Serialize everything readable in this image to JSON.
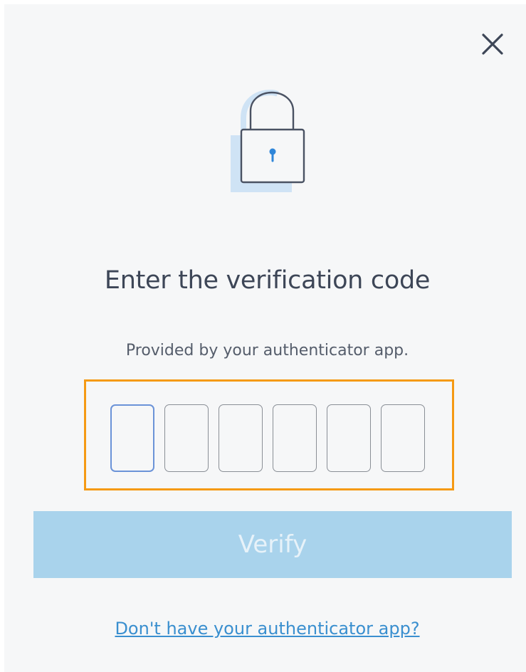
{
  "dialog": {
    "title": "Enter the verification code",
    "subtitle": "Provided by your authenticator app.",
    "code_length": 6,
    "code_digits": [
      "",
      "",
      "",
      "",
      "",
      ""
    ],
    "verify_label": "Verify",
    "help_link": "Don't have your authenticator app?"
  },
  "icons": {
    "close": "close-icon",
    "lock": "lock-icon"
  },
  "colors": {
    "panel_background": "#f6f7f8",
    "text": "#3d4657",
    "verify_button_disabled": "#a9d3ec",
    "link": "#3a8fcf",
    "highlight_border": "#f59a14",
    "focused_field_border": "#6b93d8",
    "lock_keyhole": "#2f86d9"
  }
}
